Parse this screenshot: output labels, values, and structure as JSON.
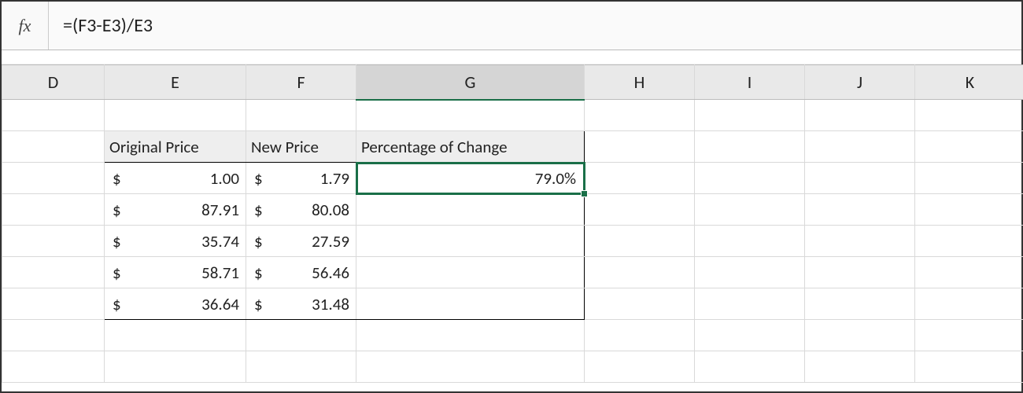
{
  "formula_bar": {
    "fx_label": "fx",
    "formula": "=(F3-E3)/E3"
  },
  "columns": {
    "D": "D",
    "E": "E",
    "F": "F",
    "G": "G",
    "H": "H",
    "I": "I",
    "J": "J",
    "K": "K"
  },
  "table": {
    "headers": {
      "original": "Original Price",
      "new": "New Price",
      "pct": "Percentage of Change"
    },
    "currency": "$",
    "rows": [
      {
        "orig": "1.00",
        "new": "1.79",
        "pct": "79.0%"
      },
      {
        "orig": "87.91",
        "new": "80.08",
        "pct": ""
      },
      {
        "orig": "35.74",
        "new": "27.59",
        "pct": ""
      },
      {
        "orig": "58.71",
        "new": "56.46",
        "pct": ""
      },
      {
        "orig": "36.64",
        "new": "31.48",
        "pct": ""
      }
    ]
  },
  "chart_data": {
    "type": "table",
    "title": "Percentage of Change",
    "columns": [
      "Original Price",
      "New Price",
      "Percentage of Change"
    ],
    "rows": [
      [
        1.0,
        1.79,
        0.79
      ],
      [
        87.91,
        80.08,
        null
      ],
      [
        35.74,
        27.59,
        null
      ],
      [
        58.71,
        56.46,
        null
      ],
      [
        36.64,
        31.48,
        null
      ]
    ]
  }
}
